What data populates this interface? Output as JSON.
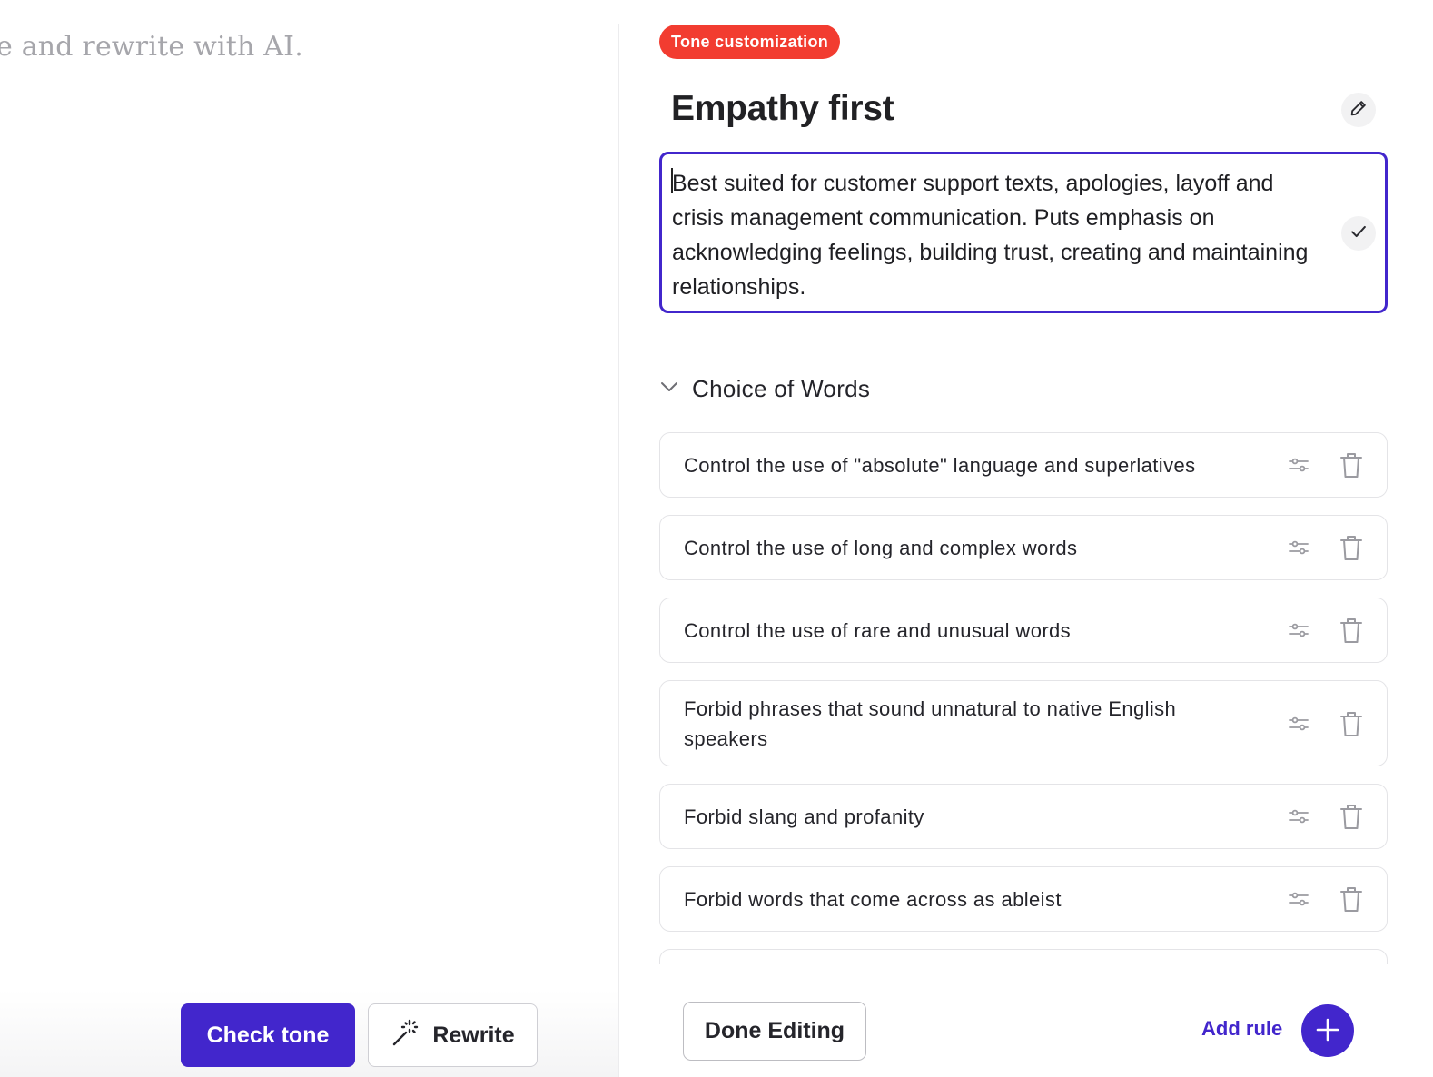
{
  "editor": {
    "placeholder_fragment": "e and rewrite with AI.",
    "check_tone_label": "Check tone",
    "rewrite_label": "Rewrite",
    "rewrite_icon": "magic-wand-icon"
  },
  "panel": {
    "badge": "Tone customization",
    "badge_color": "#f23c30",
    "title": "Empathy first",
    "edit_icon": "pencil-icon",
    "description": "Best suited for customer support texts, apologies, layoff and crisis management communication. Puts emphasis on acknowledging feelings, building trust, creating and maintaining relationships.",
    "confirm_icon": "checkmark-icon",
    "accent_color": "#4226cc",
    "section": {
      "title": "Choice of Words",
      "icon": "chevron-down-icon",
      "rules": [
        {
          "text": "Control the use of \"absolute\" language and superlatives"
        },
        {
          "text": "Control the use of long and complex words"
        },
        {
          "text": "Control the use of rare and unusual words"
        },
        {
          "text": "Forbid phrases that sound unnatural to native English speakers"
        },
        {
          "text": "Forbid slang and profanity"
        },
        {
          "text": "Forbid words that come across as ableist"
        },
        {
          "text": ""
        }
      ],
      "rule_settings_icon": "sliders-icon",
      "rule_delete_icon": "trash-icon"
    },
    "footer": {
      "done_label": "Done Editing",
      "add_rule_label": "Add rule",
      "add_icon": "plus-icon"
    }
  }
}
